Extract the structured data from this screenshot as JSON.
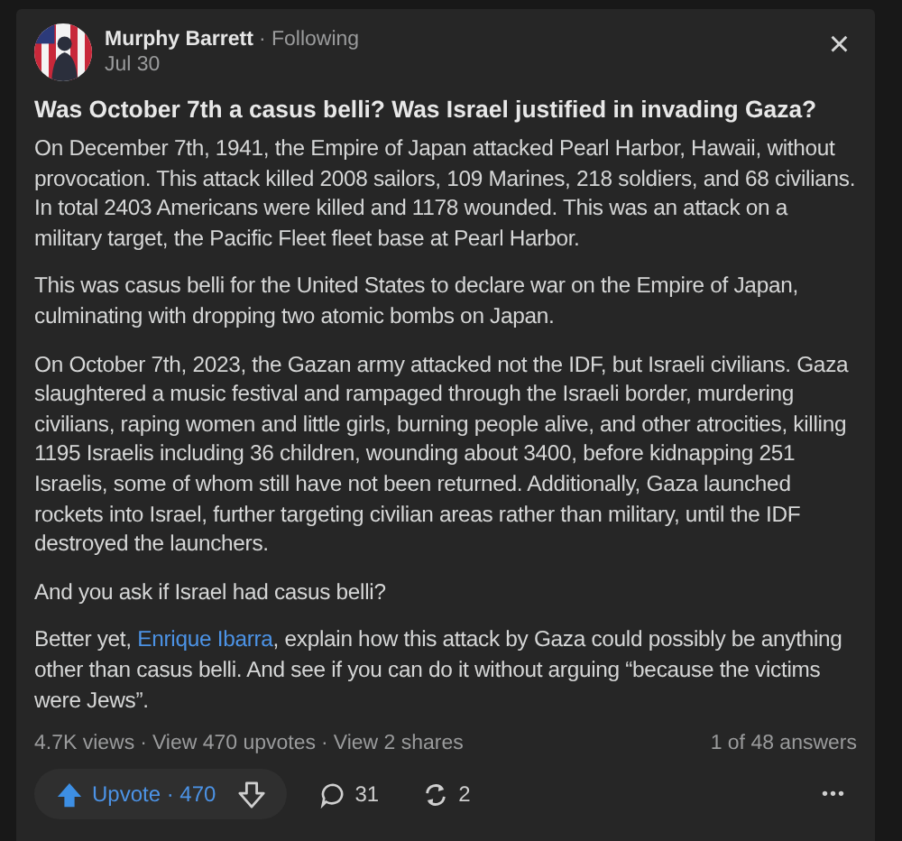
{
  "author": {
    "name": "Murphy Barrett",
    "follow_status": "· Following",
    "date": "Jul 30"
  },
  "close_label": "×",
  "question": "Was October 7th a casus belli? Was Israel justified in invading Gaza?",
  "paragraphs": [
    {
      "parts": [
        {
          "text": "On December 7th, 1941, the Empire of Japan attacked Pearl Harbor, Hawaii, without provocation. This attack killed 2008 sailors, 109 Marines, 218 soldiers, and 68 civilians. In total 2403 Americans were killed and 1178 wounded. This was an attack on a military target, the Pacific Fleet fleet base at Pearl Harbor."
        }
      ]
    },
    {
      "parts": [
        {
          "text": "This was casus belli for the United States to declare war on the Empire of Japan, culminating with dropping two atomic bombs on Japan."
        }
      ]
    },
    {
      "parts": [
        {
          "text": "On October 7th, 2023, the Gazan army attacked not the IDF, but Israeli civilians. Gaza slaughtered a music festival and rampaged through the Israeli border, murdering civilians, raping women and little girls, burning people alive, and other atrocities, killing 1195 Israelis including 36 children, wounding about 3400, before kidnapping 251 Israelis, some of whom still have not been returned. Additionally, Gaza launched rockets into Israel, further targeting civilian areas rather than military, until the IDF destroyed the launchers."
        }
      ]
    },
    {
      "parts": [
        {
          "text": "And you ask if Israel had casus belli?"
        }
      ]
    },
    {
      "parts": [
        {
          "text": "Better yet, "
        },
        {
          "text": "Enrique Ibarra",
          "kind": "link"
        },
        {
          "text": ", explain how this attack by Gaza could possibly be anything other than casus belli. And see if you can do it without arguing “because the victims were Jews”."
        }
      ]
    }
  ],
  "stats": {
    "views": "4.7K views",
    "separator": "·",
    "upvotes": "View 470 upvotes",
    "shares": "View 2 shares",
    "position": "1 of 48 answers"
  },
  "actions": {
    "upvote": "Upvote · 470",
    "comments": "31",
    "shares": "2",
    "more": "•••"
  }
}
